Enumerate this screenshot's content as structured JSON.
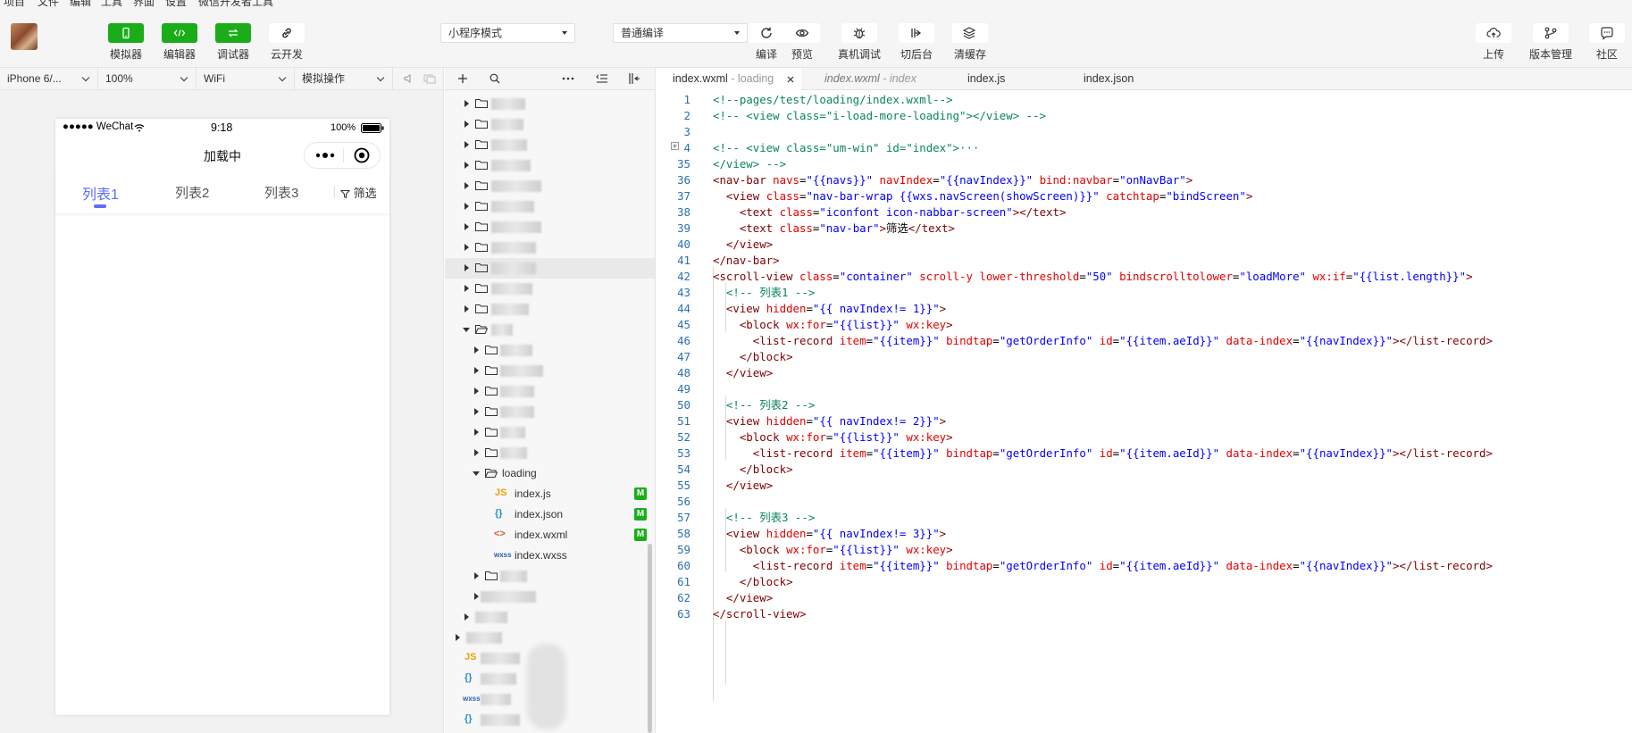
{
  "menu": {
    "items": [
      "项目",
      "文件",
      "编辑",
      "工具",
      "界面",
      "设置",
      "微信开发者工具"
    ]
  },
  "toolbar": {
    "simulator_label": "模拟器",
    "editor_label": "编辑器",
    "debugger_label": "调试器",
    "cloud_label": "云开发",
    "mode_select": "小程序模式",
    "compile_select": "普通编译",
    "compile_label": "编译",
    "preview_label": "预览",
    "remote_debug_label": "真机调试",
    "background_label": "切后台",
    "clear_cache_label": "清缓存",
    "upload_label": "上传",
    "version_label": "版本管理",
    "community_label": "社区",
    "accent_color": "#1aad19"
  },
  "simbar": {
    "device": "iPhone 6/...",
    "zoom": "100%",
    "network": "WiFi",
    "operation": "模拟操作"
  },
  "phone": {
    "carrier": "●●●●● WeChat",
    "time": "9:18",
    "battery": "100%",
    "nav_title": "加载中",
    "tabs": [
      "列表1",
      "列表2",
      "列表3"
    ],
    "filter": "筛选",
    "active_tab_color": "#5b6ef5"
  },
  "explorer": {
    "folder_loading": "loading",
    "files": [
      {
        "name": "index.js",
        "icon": "JS",
        "badge": "M"
      },
      {
        "name": "index.json",
        "icon": "{}",
        "badge": "M"
      },
      {
        "name": "index.wxml",
        "icon": "<>",
        "badge": "M"
      },
      {
        "name": "index.wxss",
        "icon": "wxss",
        "badge": ""
      }
    ]
  },
  "editor_tabs": [
    {
      "name": "index.wxml",
      "suffix": " - loading",
      "active": true
    },
    {
      "name": "index.wxml",
      "suffix": " - index",
      "active": false
    },
    {
      "name": "index.js",
      "suffix": "",
      "active": false
    },
    {
      "name": "index.json",
      "suffix": "",
      "active": false
    }
  ],
  "code": {
    "lines": [
      {
        "n": "1",
        "t": "<!--pages/test/loading/index.wxml-->"
      },
      {
        "n": "2",
        "t": "<!-- <view class=\"i-load-more-loading\"></view> -->"
      },
      {
        "n": "3",
        "t": ""
      },
      {
        "n": "4",
        "t": "<!-- <view class=\"um-win\" id=\"index\">···"
      },
      {
        "n": "35",
        "t": "</view> -->"
      },
      {
        "n": "36",
        "t": "<nav-bar navs=\"{{navs}}\" navIndex=\"{{navIndex}}\" bind:navbar=\"onNavBar\">"
      },
      {
        "n": "37",
        "t": "  <view class=\"nav-bar-wrap {{wxs.navScreen(showScreen)}}\" catchtap=\"bindScreen\">"
      },
      {
        "n": "38",
        "t": "    <text class=\"iconfont icon-nabbar-screen\"></text>"
      },
      {
        "n": "39",
        "t": "    <text class=\"nav-bar\">筛选</text>"
      },
      {
        "n": "40",
        "t": "  </view>"
      },
      {
        "n": "41",
        "t": "</nav-bar>"
      },
      {
        "n": "42",
        "t": "<scroll-view class=\"container\" scroll-y lower-threshold=\"50\" bindscrolltolower=\"loadMore\" wx:if=\"{{list.length}}\">"
      },
      {
        "n": "43",
        "t": "  <!-- 列表1 -->"
      },
      {
        "n": "44",
        "t": "  <view hidden=\"{{ navIndex!= 1}}\">"
      },
      {
        "n": "45",
        "t": "    <block wx:for=\"{{list}}\" wx:key>"
      },
      {
        "n": "46",
        "t": "      <list-record item=\"{{item}}\" bindtap=\"getOrderInfo\" id=\"{{item.aeId}}\" data-index=\"{{navIndex}}\"></list-record>"
      },
      {
        "n": "47",
        "t": "    </block>"
      },
      {
        "n": "48",
        "t": "  </view>"
      },
      {
        "n": "49",
        "t": ""
      },
      {
        "n": "50",
        "t": "  <!-- 列表2 -->"
      },
      {
        "n": "51",
        "t": "  <view hidden=\"{{ navIndex!= 2}}\">"
      },
      {
        "n": "52",
        "t": "    <block wx:for=\"{{list}}\" wx:key>"
      },
      {
        "n": "53",
        "t": "      <list-record item=\"{{item}}\" bindtap=\"getOrderInfo\" id=\"{{item.aeId}}\" data-index=\"{{navIndex}}\"></list-record>"
      },
      {
        "n": "54",
        "t": "    </block>"
      },
      {
        "n": "55",
        "t": "  </view>"
      },
      {
        "n": "56",
        "t": ""
      },
      {
        "n": "57",
        "t": "  <!-- 列表3 -->"
      },
      {
        "n": "58",
        "t": "  <view hidden=\"{{ navIndex!= 3}}\">"
      },
      {
        "n": "59",
        "t": "    <block wx:for=\"{{list}}\" wx:key>"
      },
      {
        "n": "60",
        "t": "      <list-record item=\"{{item}}\" bindtap=\"getOrderInfo\" id=\"{{item.aeId}}\" data-index=\"{{navIndex}}\"></list-record>"
      },
      {
        "n": "61",
        "t": "    </block>"
      },
      {
        "n": "62",
        "t": "  </view>"
      },
      {
        "n": "63",
        "t": "</scroll-view>"
      }
    ]
  }
}
